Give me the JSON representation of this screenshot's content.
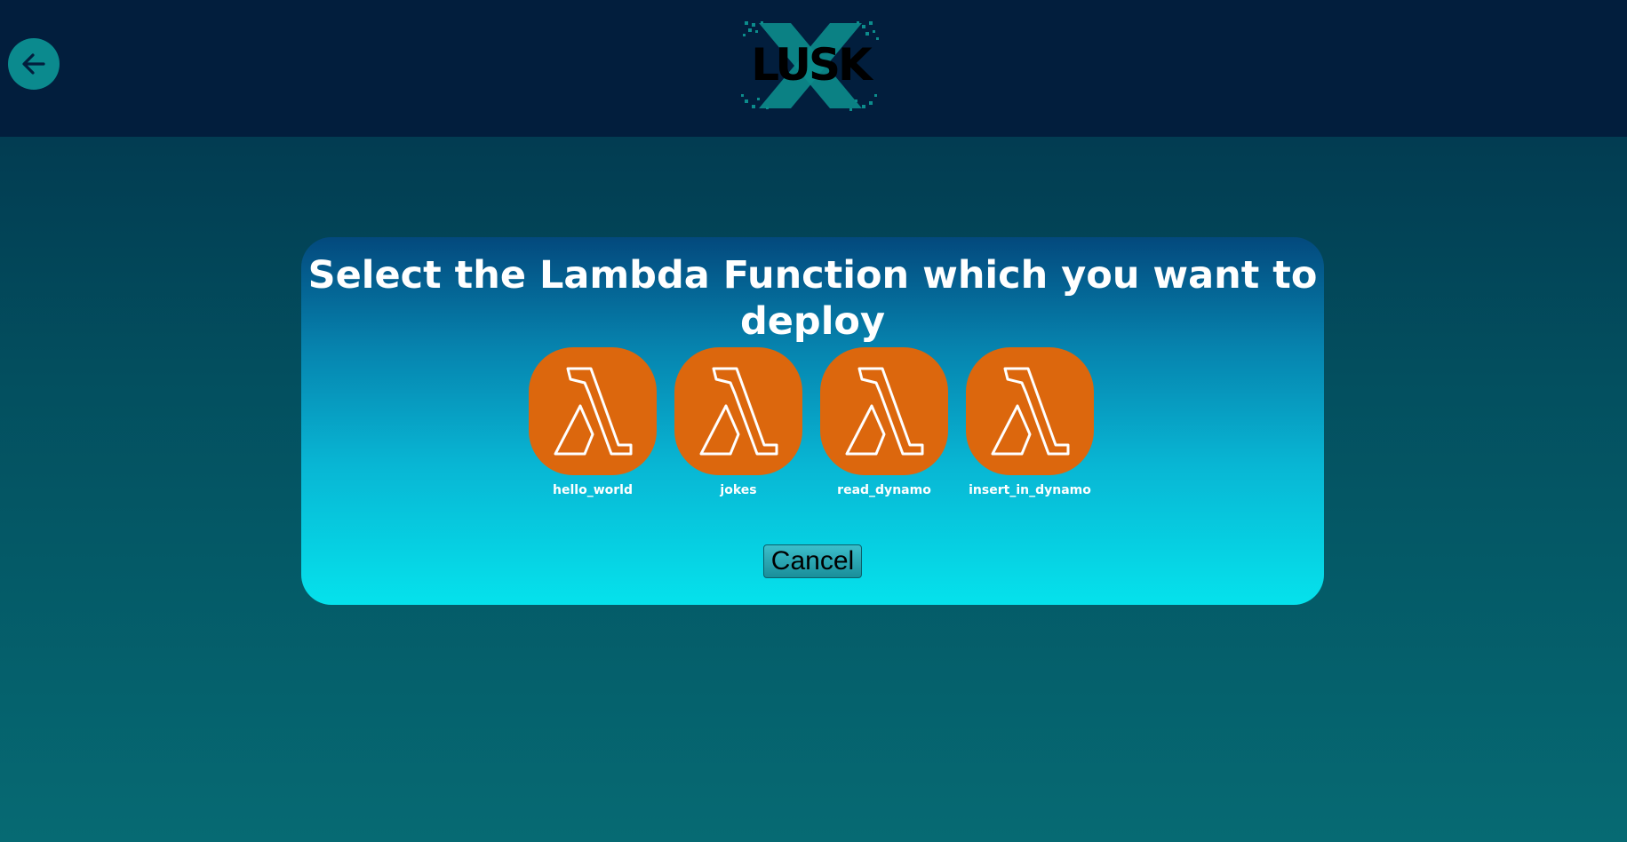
{
  "header": {
    "back_button": {
      "icon": "arrow-left-icon",
      "color": "#0b8a8e"
    },
    "logo": {
      "text": "LUSK",
      "icon": "pixel-x-logo",
      "accent": "#0c8c8c"
    }
  },
  "modal": {
    "title": "Select the Lambda Function which you want to deploy",
    "functions": [
      {
        "label": "hello_world",
        "icon": "aws-lambda-icon"
      },
      {
        "label": "jokes",
        "icon": "aws-lambda-icon"
      },
      {
        "label": "read_dynamo",
        "icon": "aws-lambda-icon"
      },
      {
        "label": "insert_in_dynamo",
        "icon": "aws-lambda-icon"
      }
    ],
    "cancel_label": "Cancel"
  },
  "colors": {
    "header_bg": "#021e3d",
    "lambda_orange": "#dc670d",
    "modal_top": "#03497d",
    "modal_bottom": "#05e2ec"
  }
}
